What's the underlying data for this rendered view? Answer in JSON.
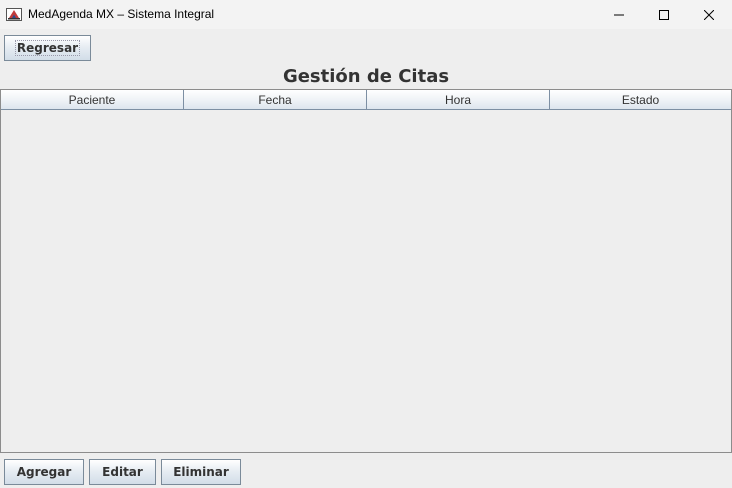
{
  "window": {
    "title": "MedAgenda MX – Sistema Integral",
    "controls": {
      "minimize": "minimize-icon",
      "maximize": "maximize-icon",
      "close": "close-icon"
    }
  },
  "toolbar": {
    "back_label": "Regresar"
  },
  "page": {
    "title": "Gestión de Citas"
  },
  "table": {
    "columns": [
      "Paciente",
      "Fecha",
      "Hora",
      "Estado"
    ],
    "rows": []
  },
  "actions": {
    "add_label": "Agregar",
    "edit_label": "Editar",
    "delete_label": "Eliminar"
  },
  "colors": {
    "background": "#eeeeee",
    "button_border": "#7a8a99",
    "header_border": "#7d8fa3",
    "text": "#333333"
  }
}
